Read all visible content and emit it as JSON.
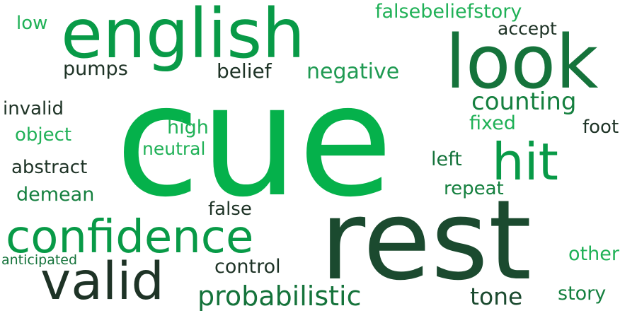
{
  "palette": {
    "bright_green": "#05b14b",
    "medium_green": "#089a47",
    "dark_green": "#15733b",
    "very_dark_green": "#1b4a2f",
    "light_green": "#20b157"
  },
  "words": [
    {
      "text": "cue",
      "color": "#05b14b"
    },
    {
      "text": "rest",
      "color": "#1b4a2f"
    },
    {
      "text": "english",
      "color": "#089a47"
    },
    {
      "text": "look",
      "color": "#15733b"
    },
    {
      "text": "confidence",
      "color": "#089a47"
    },
    {
      "text": "valid",
      "color": "#1e3326"
    },
    {
      "text": "hit",
      "color": "#089a47"
    },
    {
      "text": "probabilistic",
      "color": "#15733b"
    },
    {
      "text": "falsebeliefstory",
      "color": "#20b157"
    },
    {
      "text": "negative",
      "color": "#1f9a52"
    },
    {
      "text": "counting",
      "color": "#15803f"
    },
    {
      "text": "pumps",
      "color": "#1e3326"
    },
    {
      "text": "belief",
      "color": "#1e3326"
    },
    {
      "text": "accept",
      "color": "#1e3326"
    },
    {
      "text": "invalid",
      "color": "#1e3326"
    },
    {
      "text": "object",
      "color": "#20b157"
    },
    {
      "text": "high",
      "color": "#20b157"
    },
    {
      "text": "neutral",
      "color": "#20b157"
    },
    {
      "text": "fixed",
      "color": "#20b157"
    },
    {
      "text": "foot",
      "color": "#1e3326"
    },
    {
      "text": "abstract",
      "color": "#1e3326"
    },
    {
      "text": "left",
      "color": "#15733b"
    },
    {
      "text": "demean",
      "color": "#15803f"
    },
    {
      "text": "repeat",
      "color": "#15803f"
    },
    {
      "text": "false",
      "color": "#1e3326"
    },
    {
      "text": "control",
      "color": "#1e3326"
    },
    {
      "text": "other",
      "color": "#20b157"
    },
    {
      "text": "anticipated",
      "color": "#15733b"
    },
    {
      "text": "tone",
      "color": "#1b4a2f"
    },
    {
      "text": "story",
      "color": "#15803f"
    },
    {
      "text": "low",
      "color": "#20b157"
    }
  ]
}
